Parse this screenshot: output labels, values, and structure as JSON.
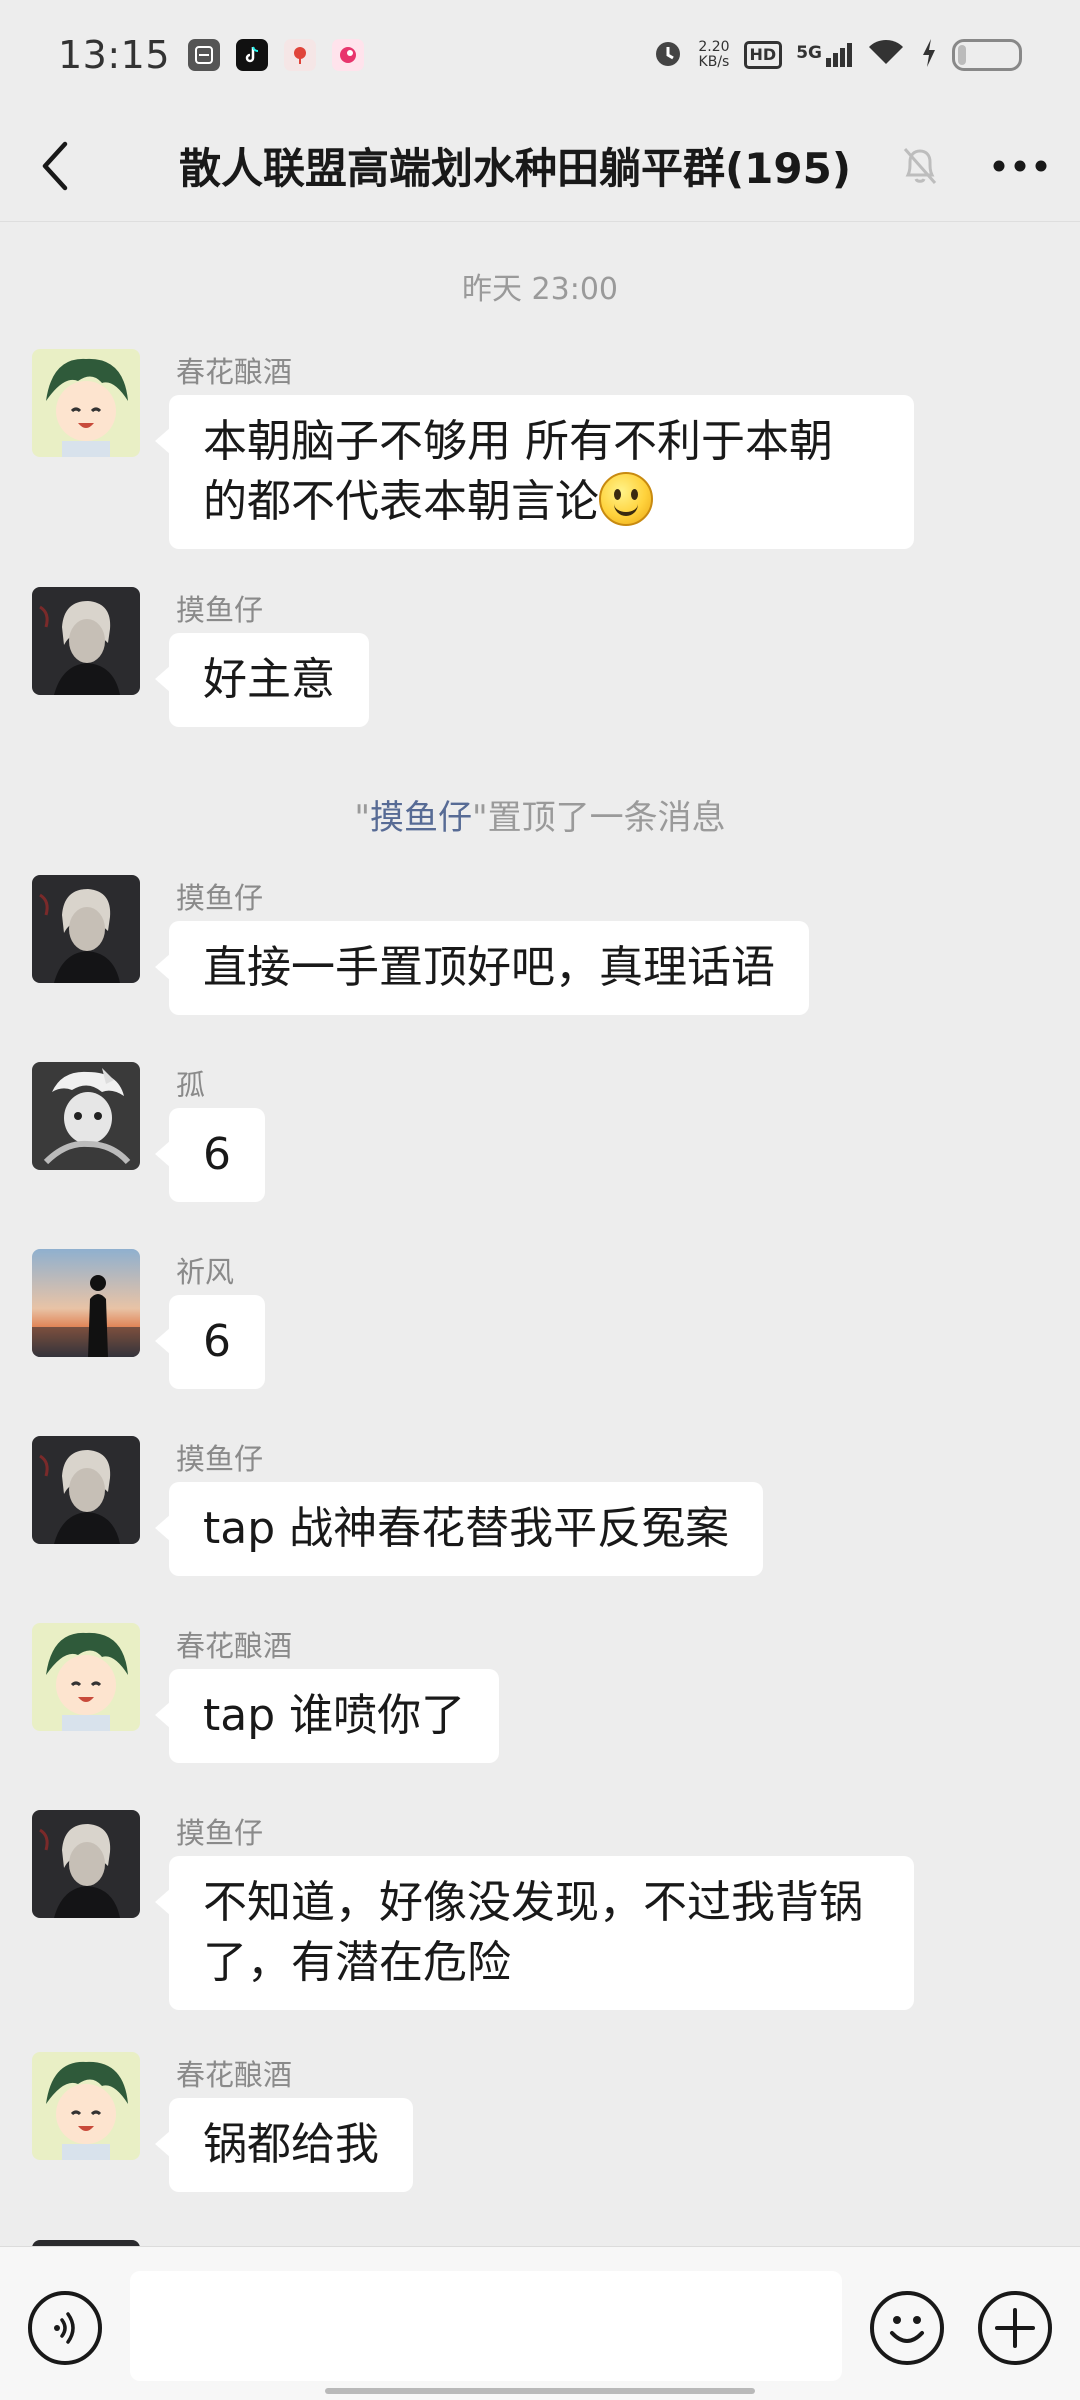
{
  "status_bar": {
    "time": "13:15",
    "net_speed_value": "2.20",
    "net_speed_unit": "KB/s",
    "hd_label": "HD",
    "signal_label": "5G",
    "icons": [
      "sim-card-icon",
      "tiktok-icon",
      "map-pin-app-icon",
      "pink-app-icon",
      "alarm-icon",
      "hd-icon",
      "signal-5g-icon",
      "wifi-icon",
      "charging-icon",
      "battery-icon"
    ]
  },
  "header": {
    "title": "散人联盟高端划水种田躺平群(195)",
    "back_icon": "back-chevron-icon",
    "mute_icon": "bell-muted-icon",
    "more_icon": "more-dots-icon"
  },
  "chat": {
    "time_divider": "昨天 23:00",
    "system_note": {
      "open_quote": "\"",
      "who": "摸鱼仔",
      "rest": "\"置顶了一条消息"
    },
    "messages": [
      {
        "sender": "春花酿酒",
        "text_line1": "本朝脑子不够用  所有不利于本朝",
        "text_line2": "的都不代表本朝言论",
        "emoji": "slightly-smiling-emoji"
      },
      {
        "sender": "摸鱼仔",
        "text": "好主意"
      },
      {
        "sender": "摸鱼仔",
        "text": "直接一手置顶好吧，真理话语"
      },
      {
        "sender": "孤",
        "text": "6"
      },
      {
        "sender": "祈风",
        "text": "6"
      },
      {
        "sender": "摸鱼仔",
        "text": "tap 战神春花替我平反冤案"
      },
      {
        "sender": "春花酿酒",
        "text": "tap 谁喷你了"
      },
      {
        "sender": "摸鱼仔",
        "text_line1": "不知道，好像没发现，不过我背锅",
        "text_line2": "了，有潜在危险"
      },
      {
        "sender": "春花酿酒",
        "text": "锅都给我"
      }
    ]
  },
  "input_bar": {
    "value": "",
    "voice_icon": "voice-input-icon",
    "emoji_icon": "emoji-icon",
    "plus_icon": "plus-icon"
  },
  "colors": {
    "background": "#ededed",
    "bubble": "#ffffff",
    "link_blue": "#576b95",
    "meta_gray": "#9a9a9a"
  }
}
